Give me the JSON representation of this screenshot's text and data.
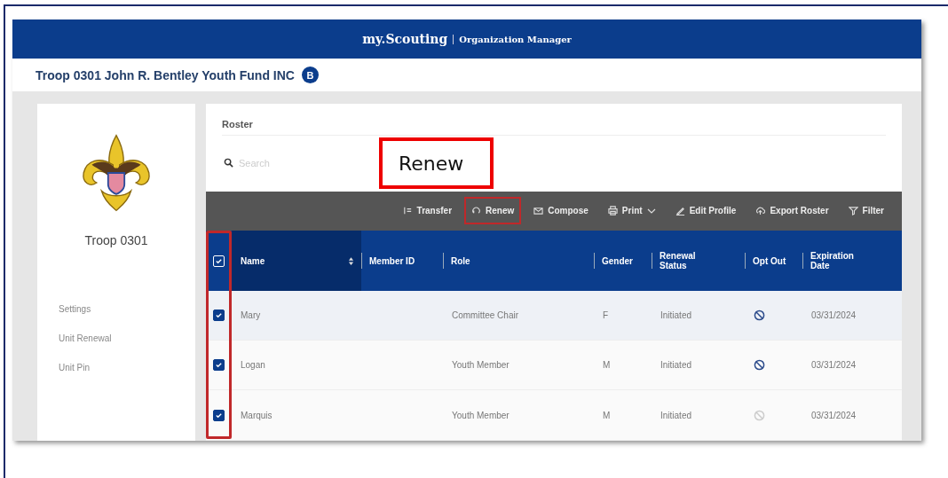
{
  "header": {
    "brand": "my.Scouting",
    "product": "Organization Manager"
  },
  "org": {
    "title": "Troop 0301 John R. Bentley Youth Fund INC",
    "badge": "B"
  },
  "sidebar": {
    "unit": "Troop 0301",
    "items": [
      {
        "label": "Settings"
      },
      {
        "label": "Unit Renewal"
      },
      {
        "label": "Unit Pin"
      }
    ]
  },
  "roster": {
    "title": "Roster",
    "search": {
      "placeholder": "Search"
    }
  },
  "toolbar": [
    {
      "label": "Transfer",
      "kind": "transfer",
      "highlighted": false
    },
    {
      "label": "Renew",
      "kind": "renew",
      "highlighted": true
    },
    {
      "label": "Compose",
      "kind": "compose",
      "highlighted": false
    },
    {
      "label": "Print",
      "kind": "print",
      "highlighted": false,
      "dropdown": true
    },
    {
      "label": "Edit Profile",
      "kind": "edit",
      "highlighted": false
    },
    {
      "label": "Export Roster",
      "kind": "export",
      "highlighted": false
    },
    {
      "label": "Filter",
      "kind": "filter",
      "highlighted": false
    }
  ],
  "table": {
    "all_checked": true,
    "checkbox_column_highlighted": true,
    "columns": [
      "Name",
      "Member ID",
      "Role",
      "Gender",
      "Renewal Status",
      "Opt Out",
      "Expiration Date"
    ],
    "rows": [
      {
        "checked": true,
        "name": "Mary",
        "role": "Committee Chair",
        "gender": "F",
        "renewal_status": "Initiated",
        "opt_out_enabled": true,
        "expiration_date": "03/31/2024"
      },
      {
        "checked": true,
        "name": "Logan",
        "role": "Youth Member",
        "gender": "M",
        "renewal_status": "Initiated",
        "opt_out_enabled": true,
        "expiration_date": "03/31/2024"
      },
      {
        "checked": true,
        "name": "Marquis",
        "role": "Youth Member",
        "gender": "M",
        "renewal_status": "Initiated",
        "opt_out_enabled": false,
        "expiration_date": "03/31/2024"
      }
    ]
  },
  "callout": {
    "label": "Renew"
  }
}
